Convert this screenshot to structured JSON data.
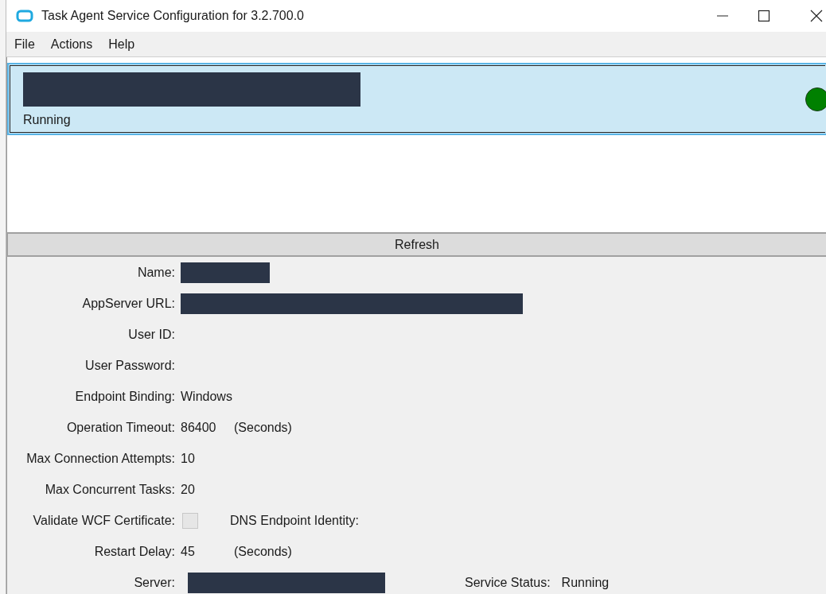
{
  "window": {
    "title": "Task Agent Service Configuration for 3.2.700.0"
  },
  "menu": [
    {
      "label": "File"
    },
    {
      "label": "Actions"
    },
    {
      "label": "Help"
    }
  ],
  "services": [
    {
      "name_redacted": true,
      "status": "Running",
      "selected": true,
      "color": "#008000"
    }
  ],
  "refresh_button": "Refresh",
  "fields": [
    {
      "label": "Name:",
      "kind": "redacted"
    },
    {
      "label": "AppServer URL:",
      "kind": "redacted"
    },
    {
      "label": "User ID:",
      "kind": "empty"
    },
    {
      "label": "User Password:",
      "kind": "empty"
    },
    {
      "label": "Endpoint Binding:",
      "kind": "text",
      "value": "Windows"
    },
    {
      "label": "Operation Timeout:",
      "kind": "text",
      "value": "86400",
      "unit": "(Seconds)"
    },
    {
      "label": "Max Connection Attempts:",
      "kind": "text",
      "value": "10"
    },
    {
      "label": "Max Concurrent Tasks:",
      "kind": "text",
      "value": "20"
    },
    {
      "label": "Validate WCF Certificate:",
      "kind": "checkbox",
      "checked": false,
      "extra_label": "DNS Endpoint Identity:"
    },
    {
      "label": "Restart Delay:",
      "kind": "text",
      "value": "45",
      "unit": "(Seconds)"
    },
    {
      "label": "Server:",
      "kind": "redacted",
      "status_label": "Service Status:",
      "status_value": "Running"
    }
  ]
}
